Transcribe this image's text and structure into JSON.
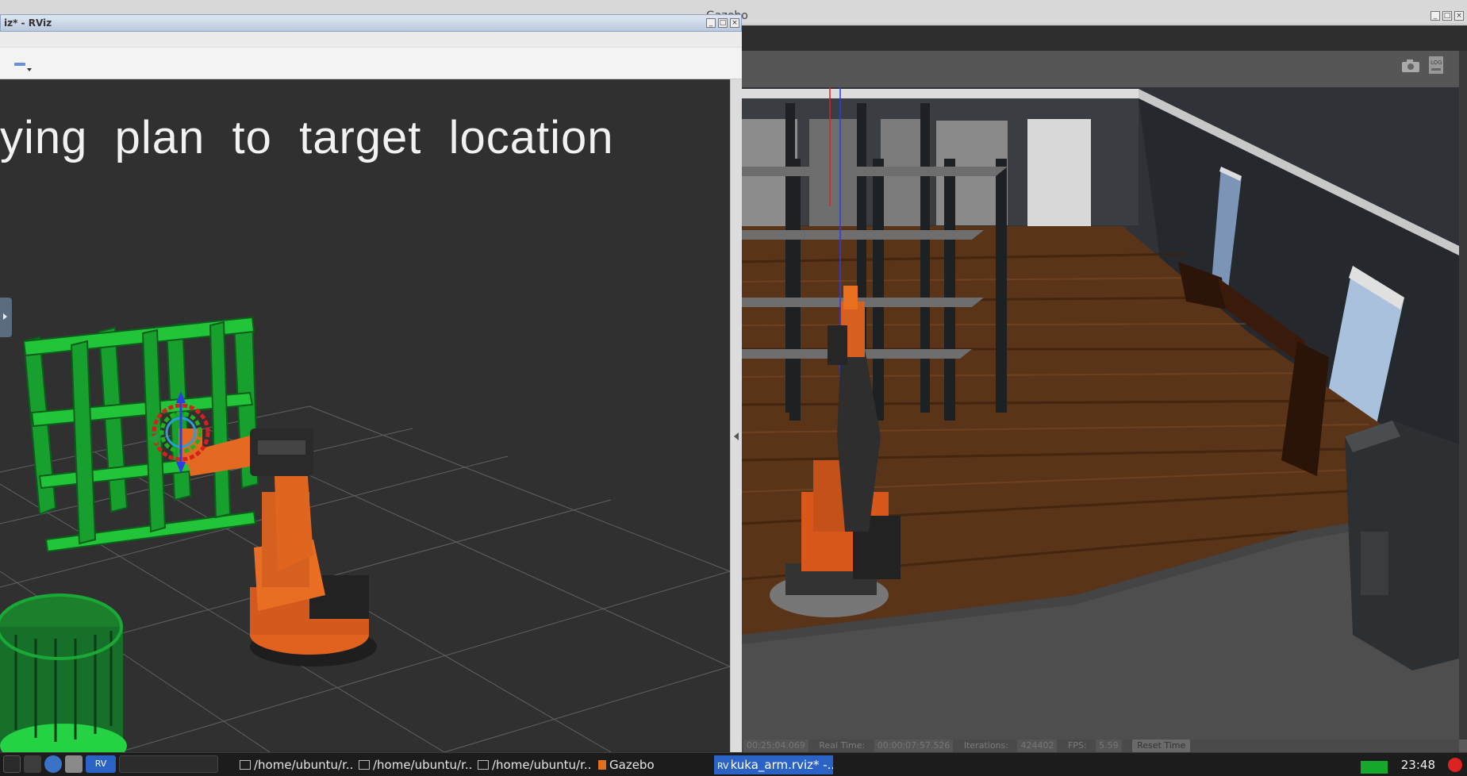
{
  "gazebo": {
    "window_title": "Gazebo",
    "status": {
      "sim_time_value": "00:25:04.069",
      "real_time_label": "Real Time:",
      "real_time_value": "00:00:07:57.526",
      "iterations_label": "Iterations:",
      "iterations_value": "424402",
      "fps_label": "FPS:",
      "fps_value": "5.59",
      "reset_button": "Reset Time"
    },
    "camera_icon": "camera-icon",
    "log_icon": "log-icon"
  },
  "rviz": {
    "window_title": "iz* - RViz",
    "overlay_text": "ying  plan  to  target  location",
    "toolbar_icon": "interact-tool-icon"
  },
  "taskbar": {
    "items": [
      {
        "label": "/home/ubuntu/r..."
      },
      {
        "label": "/home/ubuntu/r..."
      },
      {
        "label": "/home/ubuntu/r..."
      },
      {
        "label": "Gazebo"
      },
      {
        "label": "kuka_arm.rviz* -..."
      }
    ],
    "rviz_badge": "RV",
    "clock": "23:48"
  },
  "colors": {
    "rviz_bg": "#303030",
    "taskbar_active": "#2a62c6",
    "robot_orange": "#e0621e",
    "shelf_green": "#22c43a"
  }
}
